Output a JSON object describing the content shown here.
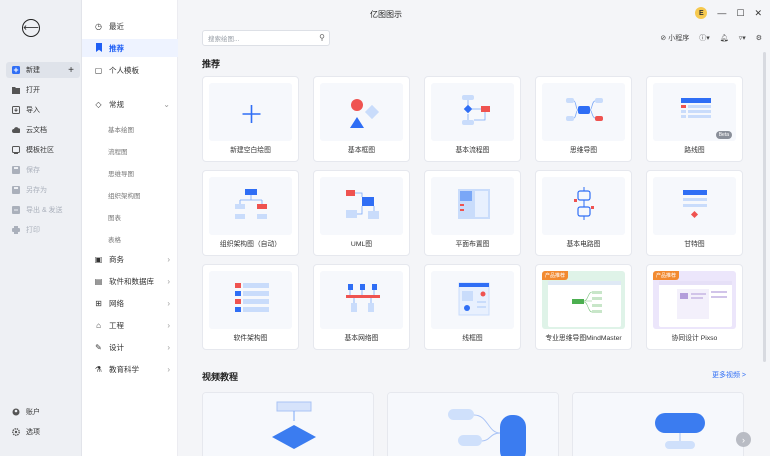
{
  "window": {
    "title": "亿图图示",
    "avatar_letter": "E",
    "minimize": "—",
    "maximize": "☐",
    "close": "✕"
  },
  "rail": {
    "back_icon": "⟵",
    "items": [
      {
        "label": "新建",
        "icon": "plus-square-icon"
      },
      {
        "label": "打开",
        "icon": "folder-icon"
      },
      {
        "label": "导入",
        "icon": "import-icon"
      },
      {
        "label": "云文档",
        "icon": "cloud-icon"
      },
      {
        "label": "模板社区",
        "icon": "community-icon"
      },
      {
        "label": "保存",
        "icon": "save-icon"
      },
      {
        "label": "另存为",
        "icon": "save-as-icon"
      },
      {
        "label": "导出 & 发送",
        "icon": "export-icon"
      },
      {
        "label": "打印",
        "icon": "print-icon"
      }
    ],
    "account_label": "账户",
    "options_label": "选项"
  },
  "categories": {
    "recent": "最近",
    "recommended": "推荐",
    "personal": "个人模板",
    "general": "常规",
    "general_subs": [
      "基本绘图",
      "流程图",
      "思维导图",
      "组织架构图",
      "图表",
      "表格"
    ],
    "business": "商务",
    "software": "软件和数据库",
    "network": "网络",
    "engineering": "工程",
    "design": "设计",
    "education": "教育科学"
  },
  "search": {
    "placeholder": "搜索绘图..."
  },
  "toolbar": {
    "mini_program": "小程序"
  },
  "recommend": {
    "title": "推荐",
    "cards": [
      {
        "label": "新建空白绘图"
      },
      {
        "label": "基本框图"
      },
      {
        "label": "基本流程图"
      },
      {
        "label": "思维导图"
      },
      {
        "label": "路线图",
        "badge": "Beta"
      },
      {
        "label": "组织架构图（自动）"
      },
      {
        "label": "UML图"
      },
      {
        "label": "平面布置图"
      },
      {
        "label": "基本电路图"
      },
      {
        "label": "甘特图"
      },
      {
        "label": "软件架构图"
      },
      {
        "label": "基本网络图"
      },
      {
        "label": "线框图"
      },
      {
        "label": "专业思维导图MindMaster",
        "tag": "产品推荐"
      },
      {
        "label": "协同设计 Pixso",
        "tag": "产品推荐"
      }
    ]
  },
  "videos": {
    "title": "视频教程",
    "more": "更多视频 >"
  },
  "colors": {
    "accent": "#1f5ff5",
    "blue": "#3b82f6",
    "red": "#ef5350",
    "light_blue": "#c9dcfb",
    "orange": "#f28a30"
  }
}
